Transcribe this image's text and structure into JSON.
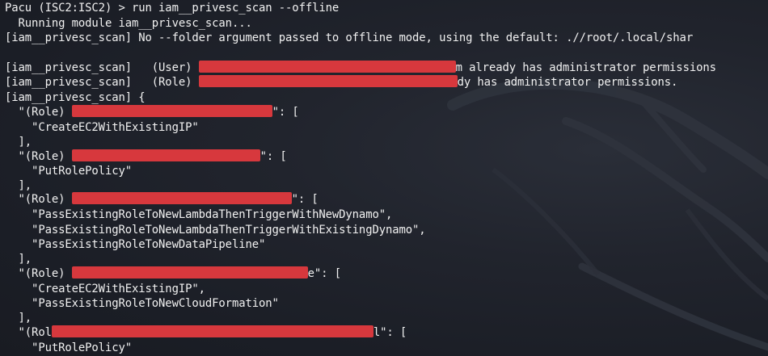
{
  "terminal": {
    "prompt": "Pacu (ISC2:ISC2) > run iam__privesc_scan --offline",
    "lines": [
      "  Running module iam__privesc_scan...",
      "[iam__privesc_scan] No --folder argument passed to offline mode, using the default: .//root/.local/shar",
      "",
      "[iam__privesc_scan]   (User) ",
      "[iam__privesc_scan]   (Role) ",
      "[iam__privesc_scan] {",
      "  \"(Role) ",
      "    \"CreateEC2WithExistingIP\"",
      "  ],",
      "  \"(Role) ",
      "    \"PutRolePolicy\"",
      "  ],",
      "  \"(Role) ",
      "    \"PassExistingRoleToNewLambdaThenTriggerWithNewDynamo\",",
      "    \"PassExistingRoleToNewLambdaThenTriggerWithExistingDynamo\",",
      "    \"PassExistingRoleToNewDataPipeline\"",
      "  ],",
      "  \"(Role) ",
      "    \"CreateEC2WithExistingIP\",",
      "    \"PassExistingRoleToNewCloudFormation\"",
      "  ],",
      "  \"(Rol",
      "    \"PutRolePolicy\""
    ],
    "suffixes": {
      "user_admin": "m already has administrator permissions",
      "role_admin": "dy has administrator permissions.",
      "role1": "\": [",
      "role2": "\": [",
      "role3": "\": [",
      "role4": "e\": [",
      "role5": "l\": ["
    }
  }
}
